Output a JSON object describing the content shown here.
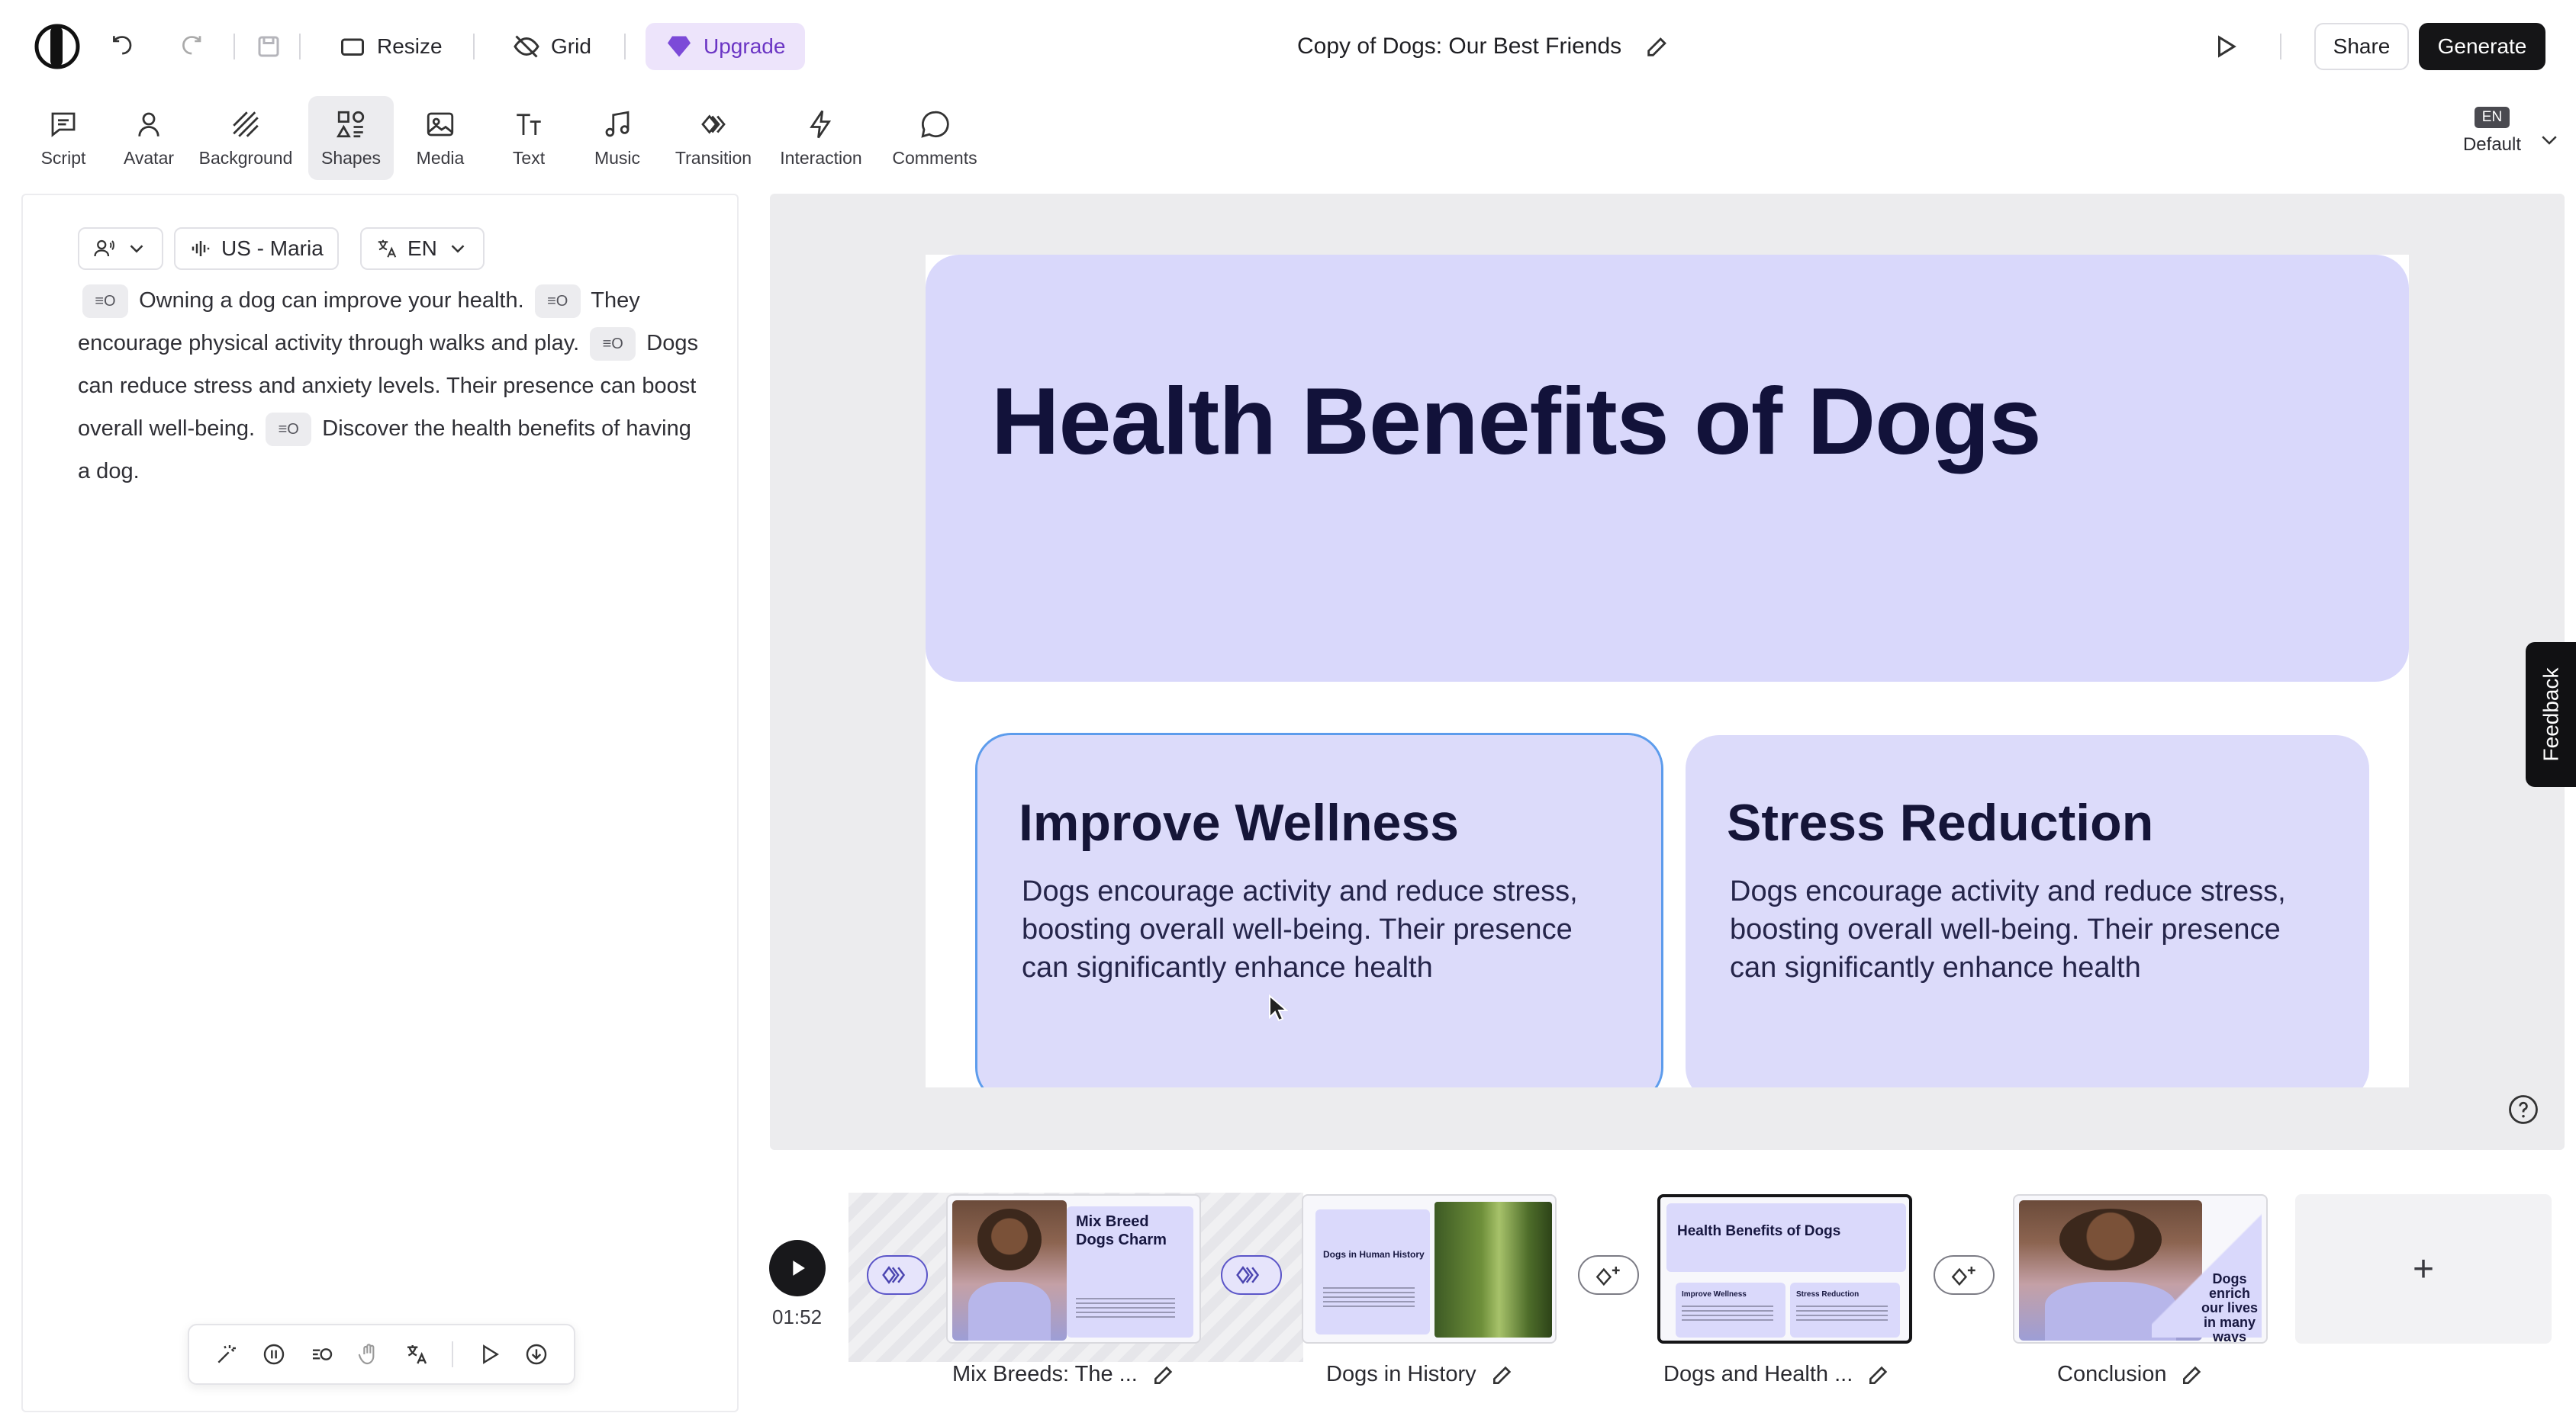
{
  "topbar": {
    "resize_label": "Resize",
    "grid_label": "Grid",
    "upgrade_label": "Upgrade",
    "doc_title": "Copy of Dogs: Our Best Friends",
    "share_label": "Share",
    "generate_label": "Generate"
  },
  "toolbar": {
    "items": [
      {
        "label": "Script",
        "icon": "script-icon"
      },
      {
        "label": "Avatar",
        "icon": "avatar-icon"
      },
      {
        "label": "Background",
        "icon": "background-icon"
      },
      {
        "label": "Shapes",
        "icon": "shapes-icon"
      },
      {
        "label": "Media",
        "icon": "media-icon"
      },
      {
        "label": "Text",
        "icon": "text-icon"
      },
      {
        "label": "Music",
        "icon": "music-icon"
      },
      {
        "label": "Transition",
        "icon": "transition-icon"
      },
      {
        "label": "Interaction",
        "icon": "interaction-icon"
      },
      {
        "label": "Comments",
        "icon": "comments-icon"
      }
    ],
    "active": "Shapes",
    "lang_badge": "EN",
    "lang_label": "Default"
  },
  "script_panel": {
    "voice_label": "US - Maria",
    "language_label": "EN",
    "segments": [
      "Owning a dog can improve your health.",
      "They encourage physical activity through walks and play.",
      "Dogs can reduce stress and anxiety levels. Their presence can boost overall well-being.",
      "Discover the health benefits of having a dog."
    ]
  },
  "slide": {
    "title": "Health Benefits of Dogs",
    "cards": [
      {
        "title": "Improve Wellness",
        "body": "Dogs encourage activity and reduce stress, boosting overall well-being. Their presence can significantly enhance health"
      },
      {
        "title": "Stress Reduction",
        "body": "Dogs encourage activity and reduce stress, boosting overall well-being. Their presence can significantly enhance health"
      }
    ]
  },
  "feedback_label": "Feedback",
  "timeline": {
    "time": "01:52",
    "add_label": "+",
    "scenes": [
      {
        "label": "Mix Breeds: The ...",
        "thumb_title": "Mix Breed Dogs Charm"
      },
      {
        "label": "Dogs in History",
        "thumb_title": "Dogs in Human History"
      },
      {
        "label": "Dogs and Health ...",
        "thumb_title": "Health Benefits of Dogs",
        "thumb_card_1": "Improve Wellness",
        "thumb_card_2": "Stress Reduction"
      },
      {
        "label": "Conclusion",
        "thumb_title": "Dogs enrich our lives in many ways"
      }
    ]
  },
  "colors": {
    "accent_purple": "#6b35c4",
    "slide_panel": "#d9d8fb",
    "title_navy": "#12123a"
  }
}
